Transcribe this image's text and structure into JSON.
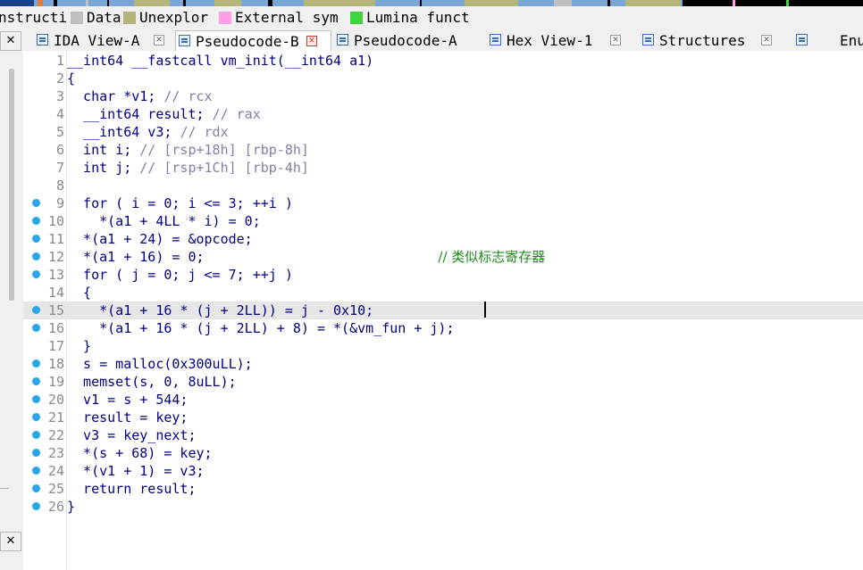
{
  "legend": {
    "items": [
      {
        "label": "nstructi",
        "color": ""
      },
      {
        "label": "Data",
        "color": "#c0c0c0"
      },
      {
        "label": "Unexplor",
        "color": "#b5b57a"
      },
      {
        "label": "External sym",
        "color": "#ff9ee5"
      },
      {
        "label": "Lumina funct",
        "color": "#3fd43f"
      }
    ]
  },
  "tabs": [
    {
      "label": "IDA View-A",
      "active": false
    },
    {
      "label": "Pseudocode-B",
      "active": true
    },
    {
      "label": "Pseudocode-A",
      "active": false
    },
    {
      "label": "Hex View-1",
      "active": false
    },
    {
      "label": "Structures",
      "active": false
    },
    {
      "label": "Enu",
      "active": false
    }
  ],
  "close_glyph": "✕",
  "code_lines": [
    {
      "n": "1",
      "bp": false,
      "text": "__int64 __fastcall vm_init(__int64 a1)"
    },
    {
      "n": "2",
      "bp": false,
      "text": "{"
    },
    {
      "n": "3",
      "bp": false,
      "text": "  char *v1; ",
      "comment": "// rcx"
    },
    {
      "n": "4",
      "bp": false,
      "text": "  __int64 result; ",
      "comment": "// rax"
    },
    {
      "n": "5",
      "bp": false,
      "text": "  __int64 v3; ",
      "comment": "// rdx"
    },
    {
      "n": "6",
      "bp": false,
      "text": "  int i; ",
      "comment": "// [rsp+18h] [rbp-8h]"
    },
    {
      "n": "7",
      "bp": false,
      "text": "  int j; ",
      "comment": "// [rsp+1Ch] [rbp-4h]"
    },
    {
      "n": "8",
      "bp": false,
      "text": ""
    },
    {
      "n": "9",
      "bp": true,
      "text": "  for ( i = 0; i <= 3; ++i )"
    },
    {
      "n": "10",
      "bp": true,
      "text": "    *(a1 + 4LL * i) = 0;"
    },
    {
      "n": "11",
      "bp": true,
      "text": "  *(a1 + 24) = &opcode;"
    },
    {
      "n": "12",
      "bp": true,
      "text": "  *(a1 + 16) = 0;                             ",
      "comment": "// 类似标志寄存器"
    },
    {
      "n": "13",
      "bp": true,
      "text": "  for ( j = 0; j <= 7; ++j )"
    },
    {
      "n": "14",
      "bp": false,
      "text": "  {"
    },
    {
      "n": "15",
      "bp": true,
      "text": "    *(a1 + 16 * (j + 2LL)) = j - 0x10;",
      "current": true
    },
    {
      "n": "16",
      "bp": true,
      "text": "    *(a1 + 16 * (j + 2LL) + 8) = *(&vm_fun + j);"
    },
    {
      "n": "17",
      "bp": false,
      "text": "  }"
    },
    {
      "n": "18",
      "bp": true,
      "text": "  s = malloc(0x300uLL);"
    },
    {
      "n": "19",
      "bp": true,
      "text": "  memset(s, 0, 8uLL);"
    },
    {
      "n": "20",
      "bp": true,
      "text": "  v1 = s + 544;"
    },
    {
      "n": "21",
      "bp": true,
      "text": "  result = key;"
    },
    {
      "n": "22",
      "bp": true,
      "text": "  v3 = key_next;"
    },
    {
      "n": "23",
      "bp": true,
      "text": "  *(s + 68) = key;"
    },
    {
      "n": "24",
      "bp": true,
      "text": "  *(v1 + 1) = v3;"
    },
    {
      "n": "25",
      "bp": true,
      "text": "  return result;"
    },
    {
      "n": "26",
      "bp": true,
      "text": "}"
    }
  ]
}
